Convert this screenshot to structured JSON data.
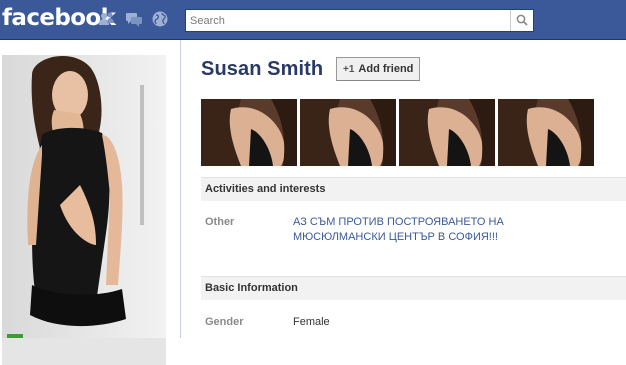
{
  "topbar": {
    "logo": "facebook",
    "icons": [
      "friend-requests-icon",
      "messages-icon",
      "notifications-globe-icon"
    ],
    "search_placeholder": "Search",
    "brand_color": "#3b5998"
  },
  "profile": {
    "name": "Susan Smith",
    "add_friend_label": "Add friend",
    "add_friend_glyph": "+1"
  },
  "photo_strip": {
    "count": 4
  },
  "sections": {
    "activities": {
      "title": "Activities and interests",
      "rows": [
        {
          "label": "Other",
          "value": "АЗ СЪМ ПРОТИВ ПОСТРОЯВАНЕТО НА МЮСЮЛМАНСКИ ЦЕНТЪР В СОФИЯ!!!"
        }
      ]
    },
    "basic": {
      "title": "Basic Information",
      "rows": [
        {
          "label": "Gender",
          "value": "Female"
        }
      ]
    }
  }
}
